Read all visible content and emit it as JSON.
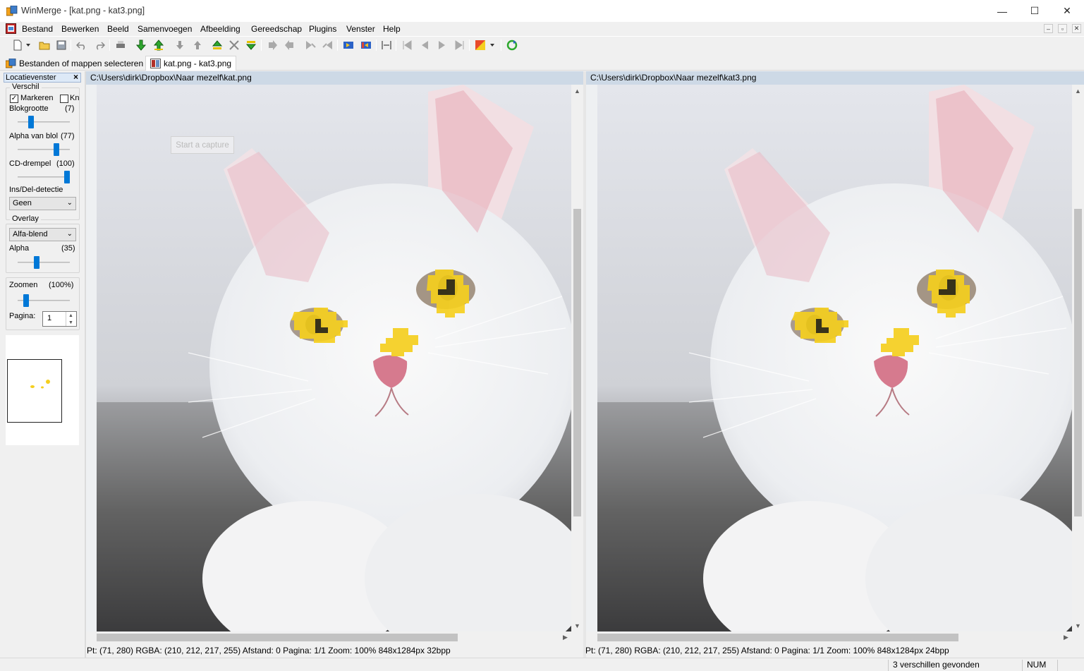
{
  "window": {
    "title": "WinMerge - [kat.png - kat3.png]",
    "controls": {
      "minimize": "—",
      "maximize": "☐",
      "close": "✕"
    }
  },
  "menu": {
    "items": [
      "Bestand",
      "Bewerken",
      "Beeld",
      "Samenvoegen",
      "Afbeelding",
      "Gereedschap",
      "Plugins",
      "Venster",
      "Help"
    ],
    "mdi_controls": [
      "–",
      "▫",
      "✕"
    ]
  },
  "tabs": [
    {
      "label": "Bestanden of mappen selecteren",
      "icon": "folder-compare-icon"
    },
    {
      "label": "kat.png - kat3.png",
      "icon": "image-compare-icon"
    }
  ],
  "location_pane": {
    "title": "Locatievenster",
    "close": "×",
    "verschil_group": "Verschil",
    "markeren_label": "Markeren",
    "markeren_checked": "✓",
    "kn_label": "Kn",
    "blokgrootte_label": "Blokgrootte",
    "blokgrootte_value": "(7)",
    "blokgrootte_level": 0.22,
    "alpha_blok_label": "Alpha van blol",
    "alpha_blok_value": "(77)",
    "alpha_blok_level": 0.77,
    "cd_label": "CD-drempel",
    "cd_value": "(100)",
    "cd_level": 1.0,
    "insdel_label": "Ins/Del-detectie",
    "insdel_value": "Geen",
    "overlay_group": "Overlay",
    "overlay_value": "Alfa-blend",
    "alpha_label": "Alpha",
    "alpha_value": "(35)",
    "alpha_level": 0.35,
    "zoom_label": "Zoomen",
    "zoom_value": "(100%)",
    "zoom_level": 0.12,
    "page_label": "Pagina:",
    "page_value": "1"
  },
  "left_pane": {
    "path": "C:\\Users\\dirk\\Dropbox\\Naar mezelf\\kat.png",
    "info": "Pt: (71, 280)  RGBA: (210, 212, 217, 255)  Afstand: 0  Pagina: 1/1  Zoom: 100%  848x1284px  32bpp",
    "overlay_button": "Start a capture"
  },
  "right_pane": {
    "path": "C:\\Users\\dirk\\Dropbox\\Naar mezelf\\kat3.png",
    "info": "Pt: (71, 280)  RGBA: (210, 212, 217, 255)  Afstand: 0  Pagina: 1/1  Zoom: 100%  848x1284px  24bpp"
  },
  "status": {
    "differences": "3 verschillen gevonden",
    "num": "NUM"
  },
  "colors": {
    "diff_highlight": "#f5cf1f",
    "path_bar": "#cdd9e6",
    "slider_accent": "#0078d7"
  }
}
